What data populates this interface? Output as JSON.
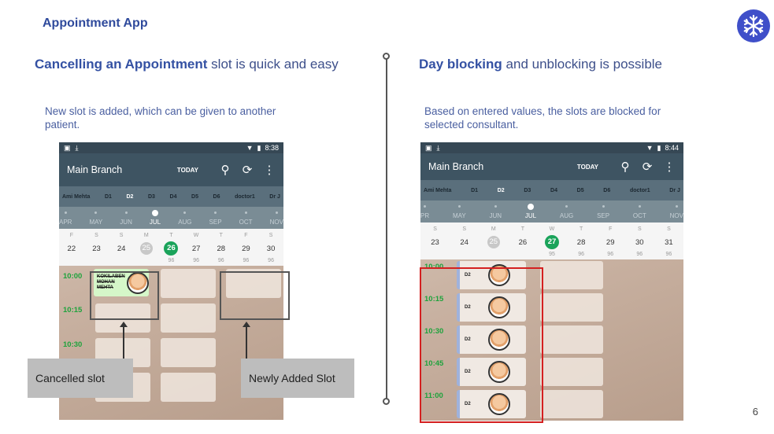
{
  "app_title": "Appointment App",
  "page_number": "6",
  "left": {
    "heading_bold": "Cancelling an Appointment",
    "heading_rest": " slot is quick and easy",
    "description": "New slot is added, which can be given to another patient.",
    "callout_cancelled": "Cancelled slot",
    "callout_new": "Newly Added Slot",
    "phone": {
      "status_time": "8:38",
      "branch": "Main Branch",
      "today": "TODAY",
      "doctors": [
        "Ami Mehta",
        "D1",
        "D2",
        "D3",
        "D4",
        "D5",
        "D6",
        "doctor1",
        "Dr J"
      ],
      "selected_doctor": "D2",
      "months": [
        "APR",
        "MAY",
        "JUN",
        "JUL",
        "AUG",
        "SEP",
        "OCT",
        "NOV"
      ],
      "selected_month": "JUL",
      "weekdays": [
        "F",
        "S",
        "S",
        "M",
        "T",
        "W",
        "T",
        "F",
        "S"
      ],
      "days": [
        "22",
        "23",
        "24",
        "25",
        "26",
        "27",
        "28",
        "29",
        "30"
      ],
      "counts": [
        "",
        "",
        "",
        "",
        "96",
        "96",
        "96",
        "96",
        "96"
      ],
      "times": [
        "10:00",
        "10:15",
        "10:30"
      ],
      "cancelled_patient": "KOKILABEN MOHAN MEHTA"
    }
  },
  "right": {
    "heading_bold": "Day blocking",
    "heading_rest": " and unblocking is possible",
    "description": "Based on entered values, the slots are blocked for selected consultant.",
    "phone": {
      "status_time": "8:44",
      "branch": "Main Branch",
      "today": "TODAY",
      "doctors": [
        "Ami Mehta",
        "D1",
        "D2",
        "D3",
        "D4",
        "D5",
        "D6",
        "doctor1",
        "Dr J"
      ],
      "selected_doctor": "D2",
      "months": [
        "PR",
        "MAY",
        "JUN",
        "JUL",
        "AUG",
        "SEP",
        "OCT",
        "NOV"
      ],
      "selected_month": "JUL",
      "weekdays": [
        "S",
        "S",
        "M",
        "T",
        "W",
        "T",
        "F",
        "S",
        "S"
      ],
      "days": [
        "23",
        "24",
        "25",
        "26",
        "27",
        "28",
        "29",
        "30",
        "31"
      ],
      "counts": [
        "",
        "",
        "",
        "",
        "95",
        "96",
        "96",
        "96",
        "96"
      ],
      "times": [
        "10:00",
        "10:15",
        "10:30",
        "10:45",
        "11:00"
      ],
      "slot_doctor": "D2"
    }
  },
  "colors": {
    "accent": "#2f4a9c",
    "today": "#1aa35a",
    "time": "#1ea33c",
    "block": "#d42020"
  }
}
